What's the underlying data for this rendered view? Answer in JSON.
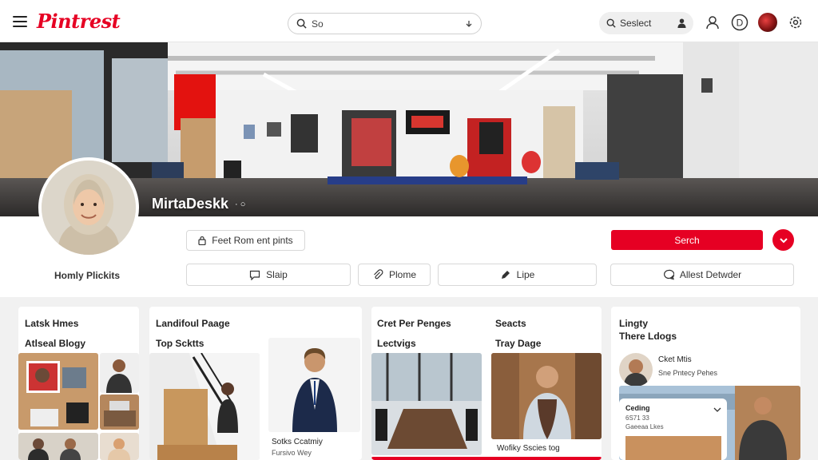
{
  "header": {
    "logo": "Pintrest",
    "search_value": "So",
    "search2_label": "Seslect"
  },
  "profile": {
    "banner_name": "MirtaDeskk",
    "name_suffix": "· ○",
    "handle": "Homly Plickits"
  },
  "actions": {
    "feed_button": "Feet Rom ent pints",
    "primary_button": "Serch",
    "tabs": [
      {
        "label": "Slaip",
        "icon": "chat-icon"
      },
      {
        "label": "Plome",
        "icon": "paperclip-icon"
      },
      {
        "label": "Lipe",
        "icon": "pen-icon"
      },
      {
        "label": "Allest Detwder",
        "icon": "comment-icon"
      }
    ]
  },
  "boards": [
    {
      "title": "Latsk Hmes",
      "subtitle": "Atlseal Blogy"
    },
    {
      "title": "Landifoul Paage",
      "subtitle": "Top Scktts",
      "caption": "Sotks Ccatmiy",
      "caption2": "Fursivo Wey"
    },
    {
      "title": "Cret Per Penges",
      "subtitle": "Lectvigs",
      "title2": "Seacts",
      "subtitle2": "Tray Dage",
      "caption": "Wofiky Sscies tog"
    },
    {
      "title": "Lingty",
      "subtitle": "There Ldogs",
      "card_name": "Cket Mtis",
      "card_sub": "Sne Pntecy Pehes",
      "card_title": "Ceding",
      "card_line1": "6S71 33",
      "card_line2": "Gaeeaa Lkes"
    }
  ],
  "colors": {
    "brand": "#e60023"
  }
}
